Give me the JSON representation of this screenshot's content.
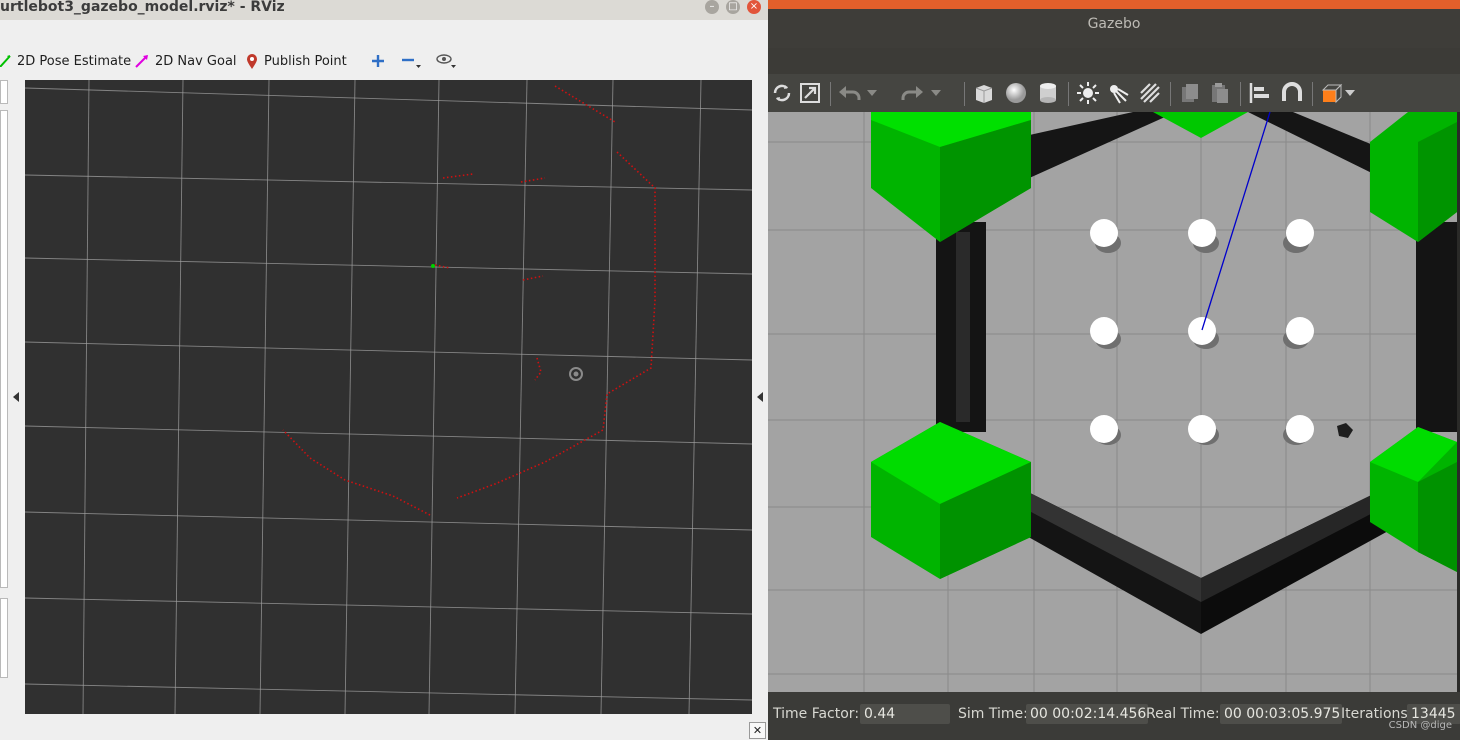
{
  "rviz": {
    "window_title": "urtlebot3_gazebo_model.rviz* - RViz",
    "toolbar": {
      "pose_estimate": "2D Pose Estimate",
      "nav_goal": "2D Nav Goal",
      "publish_point": "Publish Point"
    },
    "icons": [
      "pose-estimate-icon",
      "nav-goal-icon",
      "publish-point-icon",
      "zoom-in-icon",
      "zoom-out-icon",
      "camera-view-icon"
    ]
  },
  "gazebo": {
    "window_title": "Gazebo",
    "toolbar_icons": [
      "rotate-icon",
      "scale-icon",
      "undo-icon",
      "redo-icon",
      "box-icon",
      "sphere-icon",
      "cylinder-icon",
      "point-light-icon",
      "spot-light-icon",
      "directional-light-icon",
      "copy-icon",
      "paste-icon",
      "align-icon",
      "snap-icon",
      "view-angle-icon"
    ],
    "status": {
      "time_factor_label": "Time Factor:",
      "time_factor": "0.44",
      "sim_time_label": "Sim Time:",
      "sim_time": "00 00:02:14.456",
      "real_time_label": "Real Time:",
      "real_time": "00 00:03:05.975",
      "iterations_label": "Iterations:",
      "iterations": "13445"
    },
    "colors": {
      "ground": "#a3a3a3",
      "hex_green": "#00c000",
      "walls": "#141414",
      "ray": "#0000cc"
    }
  },
  "watermark": "CSDN @dige"
}
